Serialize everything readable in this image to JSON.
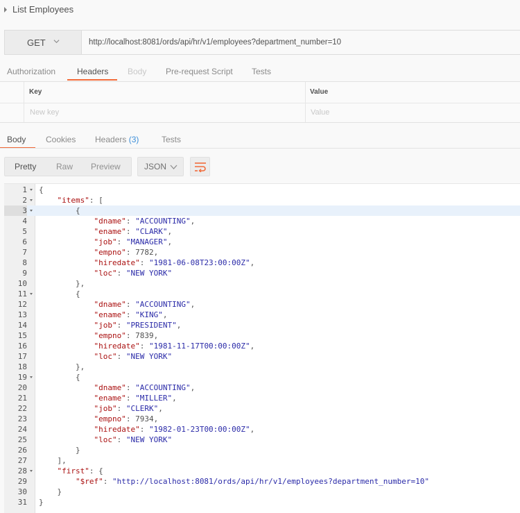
{
  "request": {
    "name": "List Employees",
    "method": "GET",
    "url": "http://localhost:8081/ords/api/hr/v1/employees?department_number=10"
  },
  "request_tabs": [
    {
      "label": "Authorization",
      "state": "normal"
    },
    {
      "label": "Headers",
      "state": "active"
    },
    {
      "label": "Body",
      "state": "disabled"
    },
    {
      "label": "Pre-request Script",
      "state": "normal"
    },
    {
      "label": "Tests",
      "state": "normal"
    }
  ],
  "headers_table": {
    "key_header": "Key",
    "value_header": "Value",
    "key_placeholder": "New key",
    "value_placeholder": "Value"
  },
  "response_tabs": [
    {
      "label": "Body",
      "state": "active"
    },
    {
      "label": "Cookies",
      "state": "normal"
    },
    {
      "label": "Headers",
      "count": "(3)",
      "state": "normal"
    },
    {
      "label": "Tests",
      "state": "normal"
    }
  ],
  "toolbar": {
    "formats": [
      "Pretty",
      "Raw",
      "Preview"
    ],
    "language": "JSON"
  },
  "colors": {
    "accent": "#f26b3a",
    "json_key": "#aa1111",
    "json_string": "#2a2aa8",
    "count": "#3d8fd9"
  },
  "code_lines": [
    "{",
    "    \"items\": [",
    "        {",
    "            \"dname\": \"ACCOUNTING\",",
    "            \"ename\": \"CLARK\",",
    "            \"job\": \"MANAGER\",",
    "            \"empno\": 7782,",
    "            \"hiredate\": \"1981-06-08T23:00:00Z\",",
    "            \"loc\": \"NEW YORK\"",
    "        },",
    "        {",
    "            \"dname\": \"ACCOUNTING\",",
    "            \"ename\": \"KING\",",
    "            \"job\": \"PRESIDENT\",",
    "            \"empno\": 7839,",
    "            \"hiredate\": \"1981-11-17T00:00:00Z\",",
    "            \"loc\": \"NEW YORK\"",
    "        },",
    "        {",
    "            \"dname\": \"ACCOUNTING\",",
    "            \"ename\": \"MILLER\",",
    "            \"job\": \"CLERK\",",
    "            \"empno\": 7934,",
    "            \"hiredate\": \"1982-01-23T00:00:00Z\",",
    "            \"loc\": \"NEW YORK\"",
    "        }",
    "    ],",
    "    \"first\": {",
    "        \"$ref\": \"http://localhost:8081/ords/api/hr/v1/employees?department_number=10\"",
    "    }",
    "}"
  ],
  "fold_lines": [
    1,
    2,
    3,
    11,
    19,
    28
  ],
  "highlighted_line": 3
}
